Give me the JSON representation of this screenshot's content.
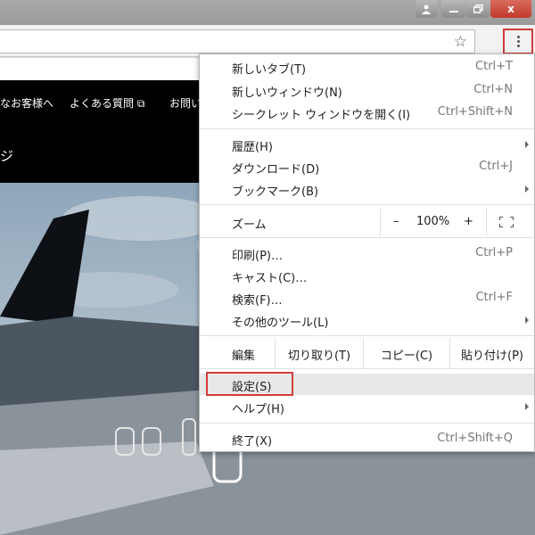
{
  "window": {
    "close_glyph": "x"
  },
  "page": {
    "nav": [
      "なお客様へ",
      "よくある質問 ⧉",
      "お問い"
    ],
    "hero_title": "ジ"
  },
  "menu": {
    "new_tab": {
      "label": "新しいタブ(T)",
      "shortcut": "Ctrl+T"
    },
    "new_window": {
      "label": "新しいウィンドウ(N)",
      "shortcut": "Ctrl+N"
    },
    "incognito": {
      "label": "シークレット ウィンドウを開く(I)",
      "shortcut": "Ctrl+Shift+N"
    },
    "history": {
      "label": "履歴(H)"
    },
    "downloads": {
      "label": "ダウンロード(D)",
      "shortcut": "Ctrl+J"
    },
    "bookmarks": {
      "label": "ブックマーク(B)"
    },
    "zoom": {
      "label": "ズーム",
      "minus": "–",
      "value": "100%",
      "plus": "+"
    },
    "print": {
      "label": "印刷(P)…",
      "shortcut": "Ctrl+P"
    },
    "cast": {
      "label": "キャスト(C)…"
    },
    "find": {
      "label": "検索(F)…",
      "shortcut": "Ctrl+F"
    },
    "more_tools": {
      "label": "その他のツール(L)"
    },
    "edit": {
      "label": "編集",
      "cut": "切り取り(T)",
      "copy": "コピー(C)",
      "paste": "貼り付け(P)"
    },
    "settings": {
      "label": "設定(S)"
    },
    "help": {
      "label": "ヘルプ(H)"
    },
    "exit": {
      "label": "終了(X)",
      "shortcut": "Ctrl+Shift+Q"
    }
  },
  "colors": {
    "highlight": "#d23b3b",
    "close_button": "#c1392b"
  }
}
